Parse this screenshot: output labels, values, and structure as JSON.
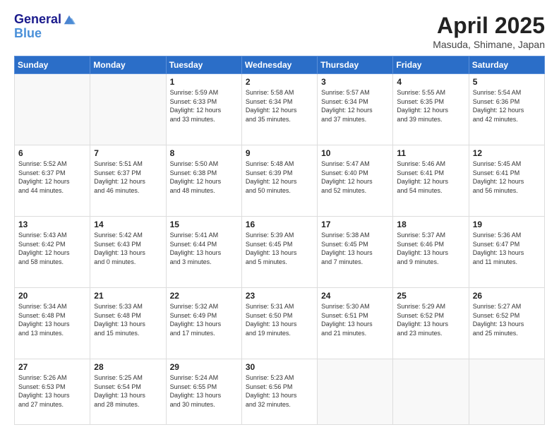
{
  "logo": {
    "line1": "General",
    "line2": "Blue"
  },
  "title": "April 2025",
  "subtitle": "Masuda, Shimane, Japan",
  "days_of_week": [
    "Sunday",
    "Monday",
    "Tuesday",
    "Wednesday",
    "Thursday",
    "Friday",
    "Saturday"
  ],
  "weeks": [
    [
      {
        "num": "",
        "info": ""
      },
      {
        "num": "",
        "info": ""
      },
      {
        "num": "1",
        "info": "Sunrise: 5:59 AM\nSunset: 6:33 PM\nDaylight: 12 hours\nand 33 minutes."
      },
      {
        "num": "2",
        "info": "Sunrise: 5:58 AM\nSunset: 6:34 PM\nDaylight: 12 hours\nand 35 minutes."
      },
      {
        "num": "3",
        "info": "Sunrise: 5:57 AM\nSunset: 6:34 PM\nDaylight: 12 hours\nand 37 minutes."
      },
      {
        "num": "4",
        "info": "Sunrise: 5:55 AM\nSunset: 6:35 PM\nDaylight: 12 hours\nand 39 minutes."
      },
      {
        "num": "5",
        "info": "Sunrise: 5:54 AM\nSunset: 6:36 PM\nDaylight: 12 hours\nand 42 minutes."
      }
    ],
    [
      {
        "num": "6",
        "info": "Sunrise: 5:52 AM\nSunset: 6:37 PM\nDaylight: 12 hours\nand 44 minutes."
      },
      {
        "num": "7",
        "info": "Sunrise: 5:51 AM\nSunset: 6:37 PM\nDaylight: 12 hours\nand 46 minutes."
      },
      {
        "num": "8",
        "info": "Sunrise: 5:50 AM\nSunset: 6:38 PM\nDaylight: 12 hours\nand 48 minutes."
      },
      {
        "num": "9",
        "info": "Sunrise: 5:48 AM\nSunset: 6:39 PM\nDaylight: 12 hours\nand 50 minutes."
      },
      {
        "num": "10",
        "info": "Sunrise: 5:47 AM\nSunset: 6:40 PM\nDaylight: 12 hours\nand 52 minutes."
      },
      {
        "num": "11",
        "info": "Sunrise: 5:46 AM\nSunset: 6:41 PM\nDaylight: 12 hours\nand 54 minutes."
      },
      {
        "num": "12",
        "info": "Sunrise: 5:45 AM\nSunset: 6:41 PM\nDaylight: 12 hours\nand 56 minutes."
      }
    ],
    [
      {
        "num": "13",
        "info": "Sunrise: 5:43 AM\nSunset: 6:42 PM\nDaylight: 12 hours\nand 58 minutes."
      },
      {
        "num": "14",
        "info": "Sunrise: 5:42 AM\nSunset: 6:43 PM\nDaylight: 13 hours\nand 0 minutes."
      },
      {
        "num": "15",
        "info": "Sunrise: 5:41 AM\nSunset: 6:44 PM\nDaylight: 13 hours\nand 3 minutes."
      },
      {
        "num": "16",
        "info": "Sunrise: 5:39 AM\nSunset: 6:45 PM\nDaylight: 13 hours\nand 5 minutes."
      },
      {
        "num": "17",
        "info": "Sunrise: 5:38 AM\nSunset: 6:45 PM\nDaylight: 13 hours\nand 7 minutes."
      },
      {
        "num": "18",
        "info": "Sunrise: 5:37 AM\nSunset: 6:46 PM\nDaylight: 13 hours\nand 9 minutes."
      },
      {
        "num": "19",
        "info": "Sunrise: 5:36 AM\nSunset: 6:47 PM\nDaylight: 13 hours\nand 11 minutes."
      }
    ],
    [
      {
        "num": "20",
        "info": "Sunrise: 5:34 AM\nSunset: 6:48 PM\nDaylight: 13 hours\nand 13 minutes."
      },
      {
        "num": "21",
        "info": "Sunrise: 5:33 AM\nSunset: 6:48 PM\nDaylight: 13 hours\nand 15 minutes."
      },
      {
        "num": "22",
        "info": "Sunrise: 5:32 AM\nSunset: 6:49 PM\nDaylight: 13 hours\nand 17 minutes."
      },
      {
        "num": "23",
        "info": "Sunrise: 5:31 AM\nSunset: 6:50 PM\nDaylight: 13 hours\nand 19 minutes."
      },
      {
        "num": "24",
        "info": "Sunrise: 5:30 AM\nSunset: 6:51 PM\nDaylight: 13 hours\nand 21 minutes."
      },
      {
        "num": "25",
        "info": "Sunrise: 5:29 AM\nSunset: 6:52 PM\nDaylight: 13 hours\nand 23 minutes."
      },
      {
        "num": "26",
        "info": "Sunrise: 5:27 AM\nSunset: 6:52 PM\nDaylight: 13 hours\nand 25 minutes."
      }
    ],
    [
      {
        "num": "27",
        "info": "Sunrise: 5:26 AM\nSunset: 6:53 PM\nDaylight: 13 hours\nand 27 minutes."
      },
      {
        "num": "28",
        "info": "Sunrise: 5:25 AM\nSunset: 6:54 PM\nDaylight: 13 hours\nand 28 minutes."
      },
      {
        "num": "29",
        "info": "Sunrise: 5:24 AM\nSunset: 6:55 PM\nDaylight: 13 hours\nand 30 minutes."
      },
      {
        "num": "30",
        "info": "Sunrise: 5:23 AM\nSunset: 6:56 PM\nDaylight: 13 hours\nand 32 minutes."
      },
      {
        "num": "",
        "info": ""
      },
      {
        "num": "",
        "info": ""
      },
      {
        "num": "",
        "info": ""
      }
    ]
  ]
}
